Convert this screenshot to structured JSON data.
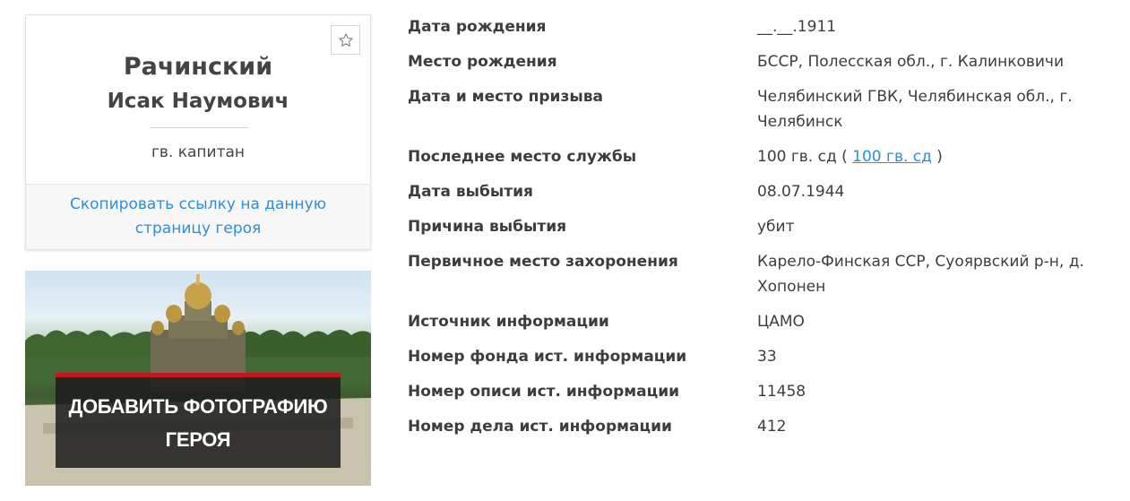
{
  "hero": {
    "surname": "Рачинский",
    "given_names": "Исак Наумович",
    "rank": "гв. капитан",
    "copy_link": "Скопировать ссылку на данную страницу героя",
    "favorite_icon": "star-outline-icon"
  },
  "photo_banner": {
    "cta": "ДОБАВИТЬ ФОТОГРАФИЮ ГЕРОЯ",
    "accent": "#c4161c"
  },
  "details": [
    {
      "label": "Дата рождения",
      "value": "__.__.1911"
    },
    {
      "label": "Место рождения",
      "value": "БССР, Полесская обл., г. Калинковичи"
    },
    {
      "label": "Дата и место призыва",
      "value": "Челябинский ГВК, Челябинская обл., г. Челябинск"
    },
    {
      "label": "Последнее место службы",
      "value_prefix": "100 гв. сд (",
      "value_link": "100 гв. сд",
      "value_suffix": ")"
    },
    {
      "label": "Дата выбытия",
      "value": "08.07.1944"
    },
    {
      "label": "Причина выбытия",
      "value": "убит"
    },
    {
      "label": "Первичное место захоронения",
      "value": "Карело-Финская ССР, Суоярвский р-н, д. Хопонен"
    },
    {
      "label": "Источник информации",
      "value": "ЦАМО"
    },
    {
      "label": "Номер фонда ист. информации",
      "value": "33"
    },
    {
      "label": "Номер описи ист. информации",
      "value": "11458"
    },
    {
      "label": "Номер дела ист. информации",
      "value": "412"
    }
  ],
  "colors": {
    "link": "#2e8fd5",
    "text": "#3d3d3d"
  }
}
